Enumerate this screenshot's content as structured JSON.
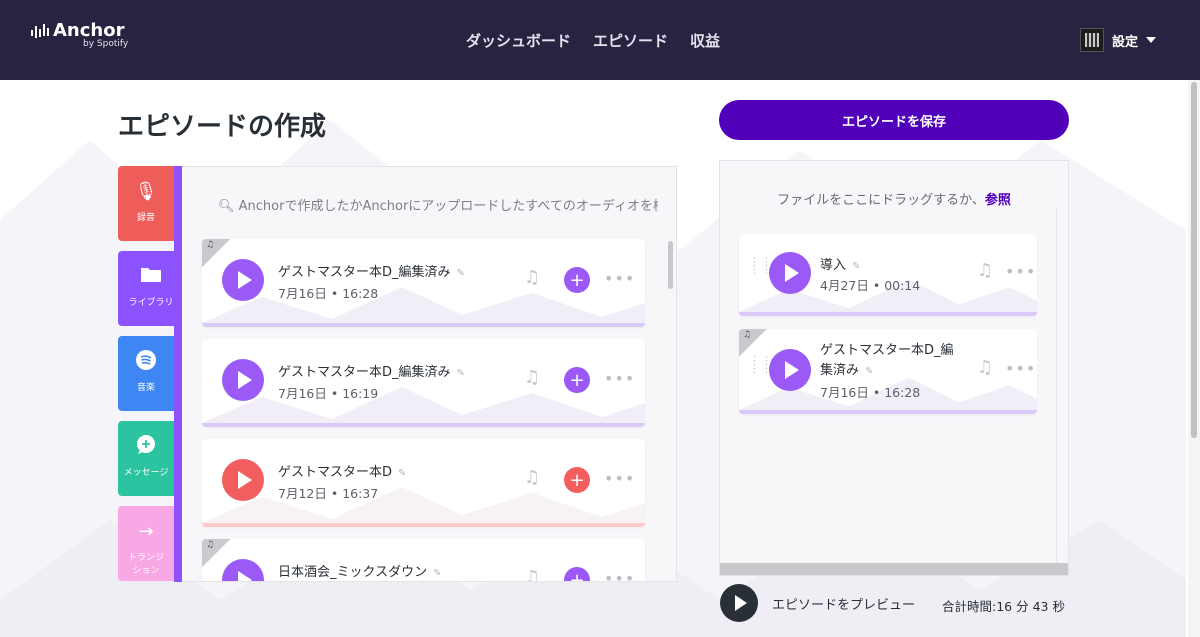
{
  "header": {
    "logo_main": "Anchor",
    "logo_sub": "by Spotify",
    "nav": [
      "ダッシュボード",
      "エピソード",
      "収益"
    ],
    "settings_label": "設定"
  },
  "page": {
    "title": "エピソードの作成",
    "save_button": "エピソードを保存"
  },
  "tabs": [
    {
      "label": "録音",
      "icon": "microphone-icon"
    },
    {
      "label": "ライブラリ",
      "icon": "folder-icon"
    },
    {
      "label": "音楽",
      "icon": "spotify-icon"
    },
    {
      "label": "メッセージ",
      "icon": "message-plus-icon"
    },
    {
      "label": "トランジション",
      "icon": "arrow-right-icon"
    }
  ],
  "library": {
    "search_placeholder": "Anchorで作成したかAnchorにアップロードしたすべてのオーディオを検索",
    "items": [
      {
        "title": "ゲストマスター本D_編集済み",
        "date": "7月16日",
        "time": "16:28",
        "color": "#9b59f5",
        "has_corner": true
      },
      {
        "title": "ゲストマスター本D_編集済み",
        "date": "7月16日",
        "time": "16:19",
        "color": "#9b59f5",
        "has_corner": false
      },
      {
        "title": "ゲストマスター本D",
        "date": "7月12日",
        "time": "16:37",
        "color": "#f25e5e",
        "has_corner": false
      },
      {
        "title": "日本酒会_ミックスダウン",
        "date": "",
        "time": "",
        "color": "#9b59f5",
        "has_corner": true
      }
    ]
  },
  "timeline": {
    "drop_text": "ファイルをここにドラッグするか、",
    "drop_link": "参照",
    "items": [
      {
        "title_line1": "導入",
        "title_line2": "",
        "date": "4月27日",
        "time": "00:14",
        "has_corner": false
      },
      {
        "title_line1": "ゲストマスター本D_編",
        "title_line2": "集済み",
        "date": "7月16日",
        "time": "16:28",
        "has_corner": true
      }
    ]
  },
  "footer": {
    "preview_label": "エピソードをプレビュー",
    "total_label": "合計時間:",
    "total_value": "16 分 43 秒"
  },
  "colors": {
    "header_bg": "#292240",
    "accent_purple": "#5000b9",
    "library_purple": "#8c52ff",
    "record_red": "#ee5d5a",
    "music_blue": "#3f86f5",
    "message_green": "#2cc3a1",
    "transition_pink": "#f9a8e6"
  }
}
